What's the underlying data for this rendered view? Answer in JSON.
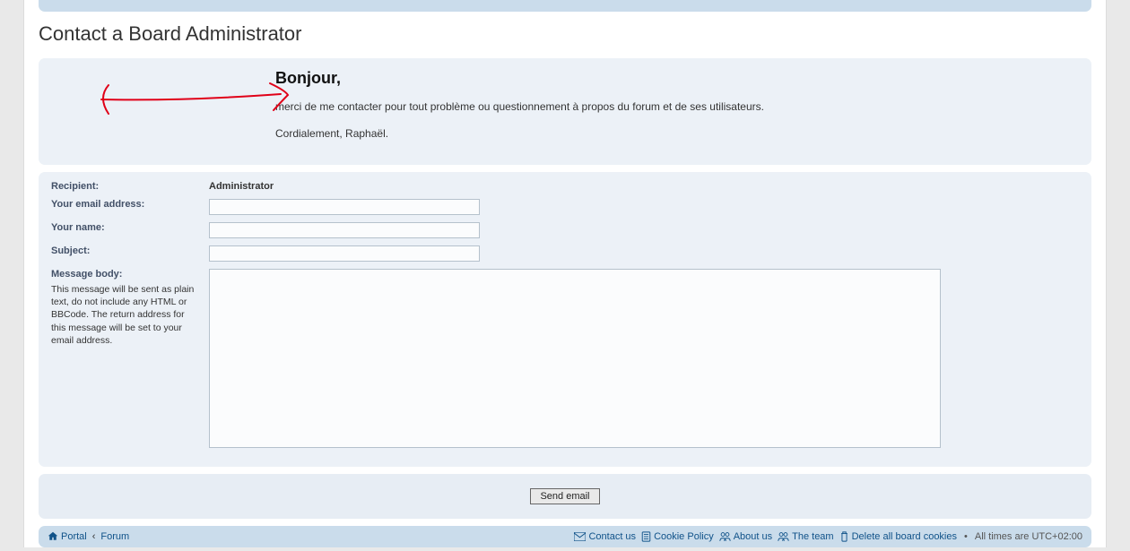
{
  "page_title": "Contact a Board Administrator",
  "intro": {
    "heading": "Bonjour,",
    "line1": "merci de me contacter pour tout problème ou questionnement à propos du forum et de ses utilisateurs.",
    "line2": "Cordialement, Raphaël."
  },
  "form": {
    "recipient_label": "Recipient:",
    "recipient_value": "Administrator",
    "email_label": "Your email address:",
    "email_value": "",
    "name_label": "Your name:",
    "name_value": "",
    "subject_label": "Subject:",
    "subject_value": "",
    "message_label": "Message body:",
    "message_desc": "This message will be sent as plain text, do not include any HTML or BBCode. The return address for this message will be set to your email address.",
    "message_value": "",
    "submit_label": "Send email"
  },
  "nav": {
    "portal": "Portal",
    "forum": "Forum",
    "contact_us": "Contact us",
    "cookie_policy": "Cookie Policy",
    "about_us": "About us",
    "the_team": "The team",
    "delete_cookies": "Delete all board cookies",
    "all_times": "All times are ",
    "tz": "UTC+02:00"
  }
}
